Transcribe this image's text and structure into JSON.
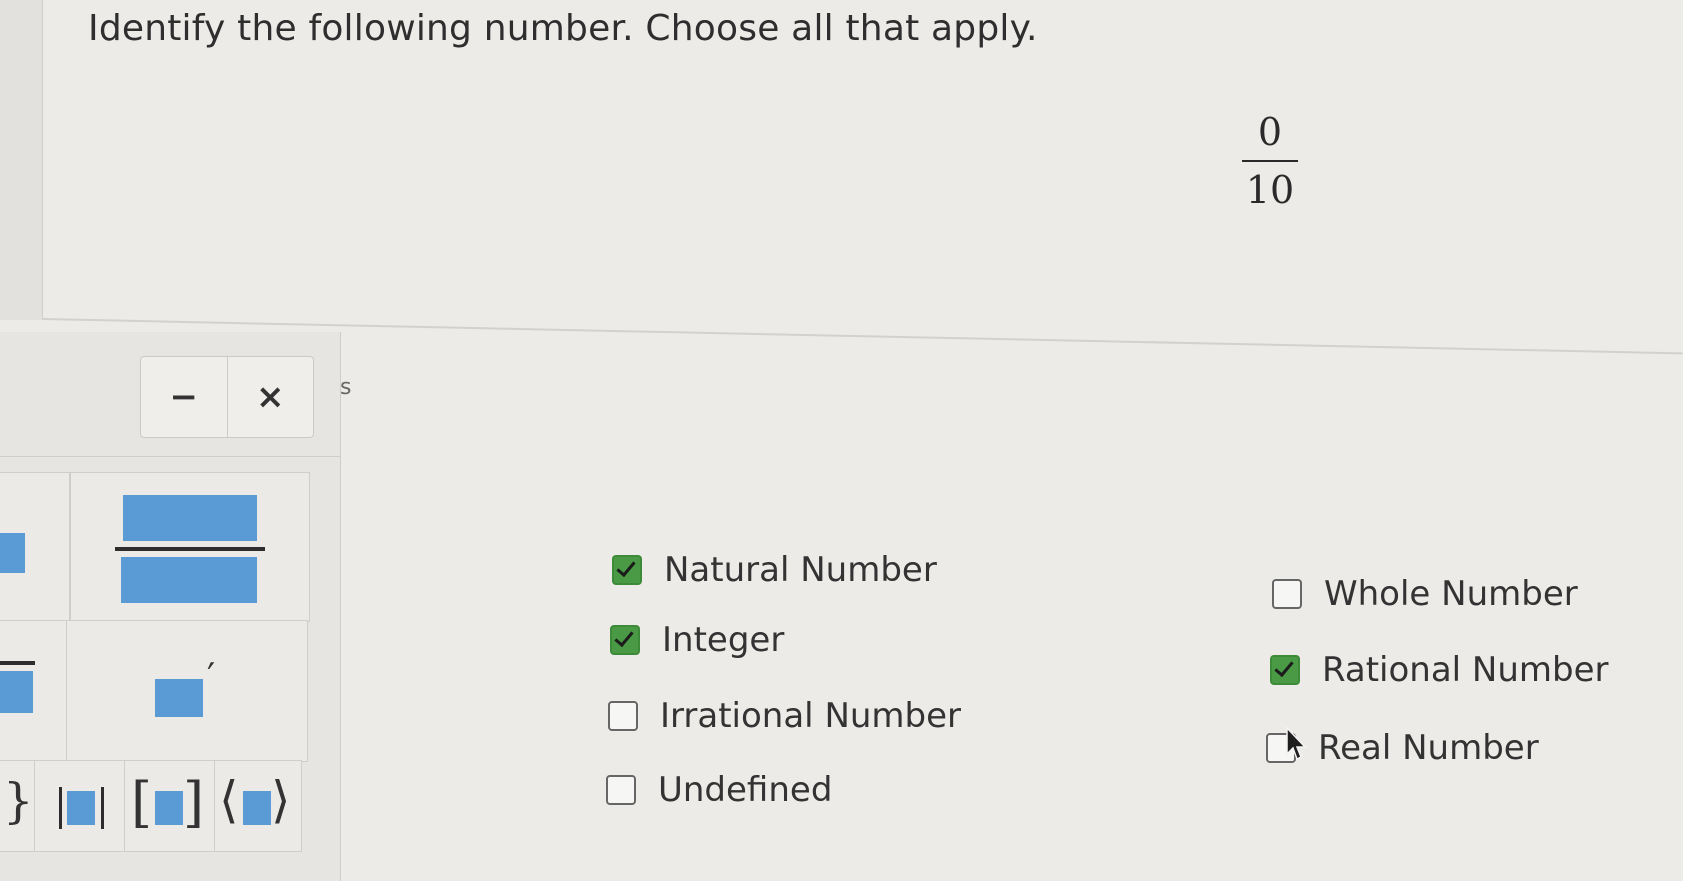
{
  "question": {
    "text": "Identify the following number. Choose all that apply."
  },
  "expression": {
    "numerator": "0",
    "denominator": "10"
  },
  "palette": {
    "minimize_label": "−",
    "close_label": "×",
    "prime_symbol": "′",
    "brace_symbol": "}",
    "bracket_left": "[",
    "bracket_right": "]",
    "angle_left": "⟨",
    "angle_right": "⟩",
    "stray_char": "s"
  },
  "options": [
    {
      "label": "Natural Number",
      "checked": true
    },
    {
      "label": "Integer",
      "checked": true
    },
    {
      "label": "Irrational Number",
      "checked": false
    },
    {
      "label": "Undefined",
      "checked": false
    },
    {
      "label": "Whole Number",
      "checked": false
    },
    {
      "label": "Rational Number",
      "checked": true
    },
    {
      "label": "Real Number",
      "checked": false
    }
  ],
  "colors": {
    "check_green": "#4a9a45",
    "palette_blue": "#5b9bd5"
  }
}
